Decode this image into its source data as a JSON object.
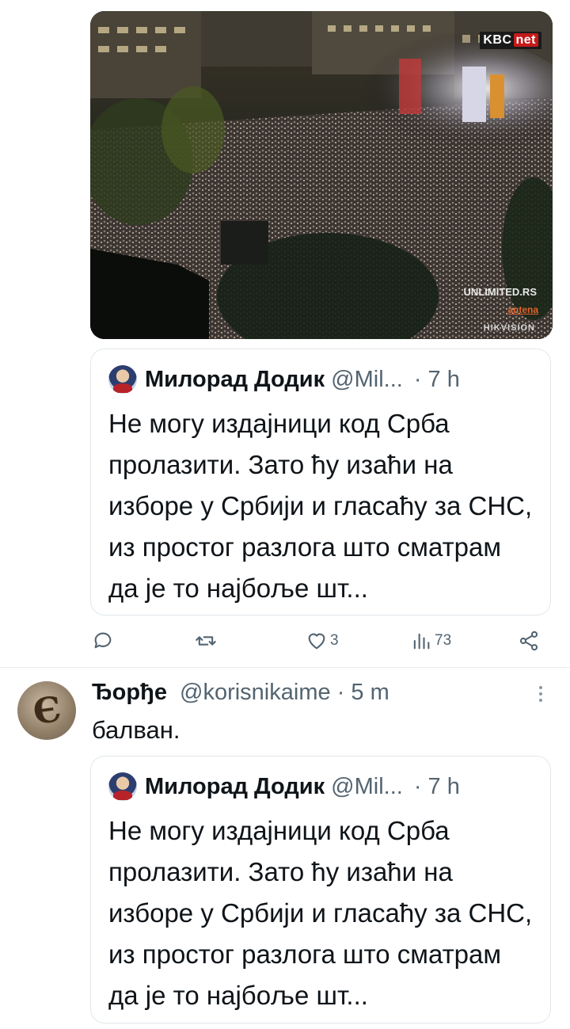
{
  "media": {
    "watermarks": {
      "kbc_prefix": "KBC",
      "kbc_suffix": "net",
      "unlimited": "UNLIMITED.RS",
      "antena": "antena",
      "hikvision": "HIKVISION"
    }
  },
  "quoted_tweet_1": {
    "author_name": "Милорад Додик",
    "handle": "@Mil...",
    "time": "· 7 h",
    "text": "Не могу издајници код Срба пролазити. Зато ћу изаћи на изборе у Србији и гласаћу за СНС, из простог разлога што сматрам да је то најбоље шт..."
  },
  "actions": {
    "replies": "",
    "retweets": "",
    "likes": "3",
    "views": "73"
  },
  "tweet_2": {
    "author_name": "Ђорђе",
    "handle": "@korisnikaime",
    "time": "· 5 m",
    "text": "балван.",
    "avatar_glyph": "Є"
  },
  "quoted_tweet_2": {
    "author_name": "Милорад Додик",
    "handle": "@Mil...",
    "time": "· 7 h",
    "text": "Не могу издајници код Срба пролазити. Зато ћу изаћи на изборе у Србији и гласаћу за СНС, из простог разлога што сматрам да је то најбоље шт..."
  },
  "icons": [
    "reply-icon",
    "retweet-icon",
    "like-icon",
    "views-icon",
    "share-icon",
    "more-icon"
  ],
  "colors": {
    "text": "#0f1419",
    "secondary": "#536471",
    "border": "#e1e8ed"
  }
}
